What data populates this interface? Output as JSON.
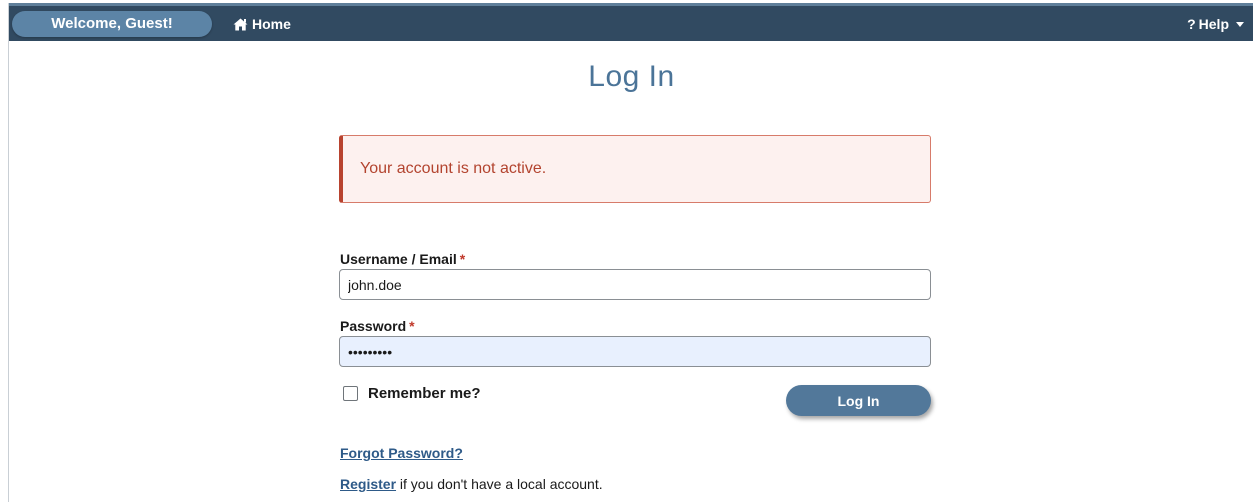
{
  "colors": {
    "navbar": "#314a61",
    "welcome_pill": "#5c84a6",
    "title": "#4b7498",
    "alert_border": "#b8432f",
    "alert_text": "#b3442f",
    "alert_bg": "#fdf1ef",
    "button": "#52789a",
    "link": "#2e5a88",
    "required": "#c0392b"
  },
  "navbar": {
    "welcome": "Welcome, Guest!",
    "home_label": "Home",
    "home_icon": "home-icon",
    "help_label": "Help",
    "help_icon": "question-icon"
  },
  "page": {
    "title": "Log In"
  },
  "alert": {
    "message": "Your account is not active."
  },
  "form": {
    "username_label": "Username / Email",
    "username_value": "john.doe",
    "password_label": "Password",
    "password_value": "password1",
    "required_marker": "*",
    "remember_label": "Remember me?",
    "remember_checked": false,
    "submit_label": "Log In"
  },
  "links": {
    "forgot_password": "Forgot Password?",
    "register": "Register",
    "register_suffix": " if you don't have a local account."
  }
}
